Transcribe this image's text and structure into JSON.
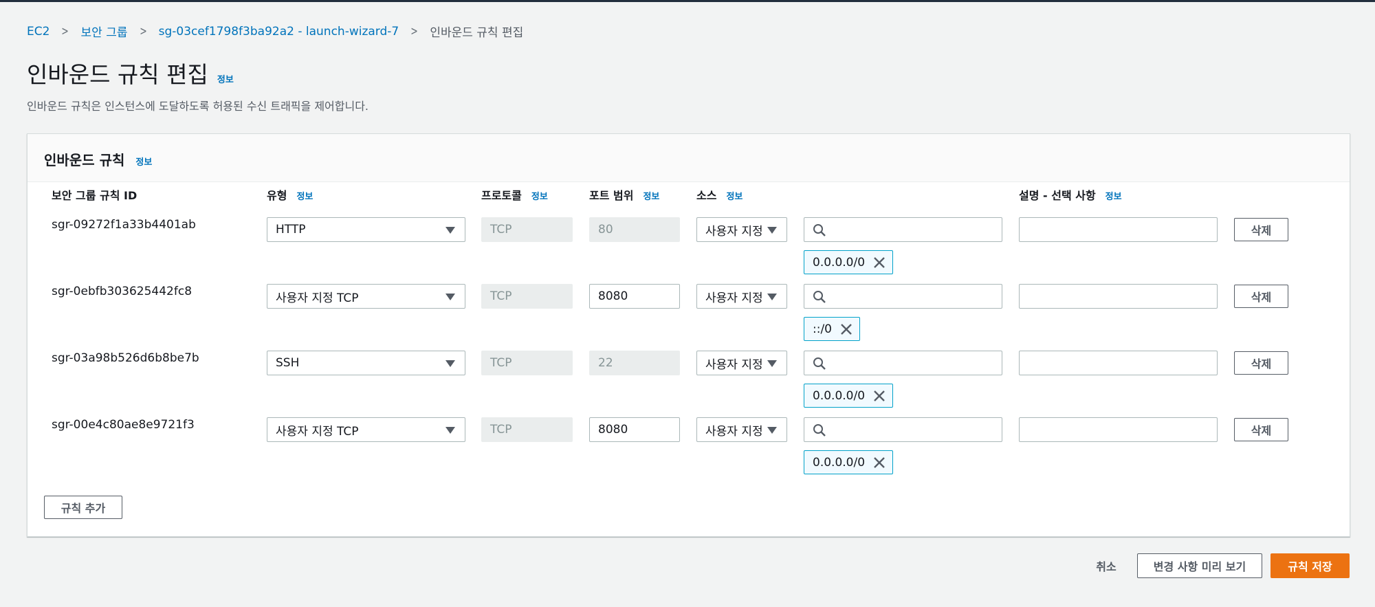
{
  "breadcrumb": {
    "items": [
      "EC2",
      "보안 그룹",
      "sg-03cef1798f3ba92a2 - launch-wizard-7"
    ],
    "current": "인바운드 규칙 편집"
  },
  "page": {
    "title": "인바운드 규칙 편집",
    "info": "정보",
    "description": "인바운드 규칙은 인스턴스에 도달하도록 허용된 수신 트래픽을 제어합니다."
  },
  "panel": {
    "title": "인바운드 규칙",
    "info": "정보",
    "columns": {
      "rule_id": "보안 그룹 규칙 ID",
      "type": "유형",
      "protocol": "프로토콜",
      "port_range": "포트 범위",
      "source": "소스",
      "description": "설명 - 선택 사항",
      "info": "정보"
    },
    "rules": [
      {
        "id": "sgr-09272f1a33b4401ab",
        "type": "HTTP",
        "protocol": "TCP",
        "port": "80",
        "port_editable": false,
        "source_type": "사용자 지정",
        "search_value": "",
        "cidr": "0.0.0.0/0",
        "description": "",
        "delete": "삭제"
      },
      {
        "id": "sgr-0ebfb303625442fc8",
        "type": "사용자 지정 TCP",
        "protocol": "TCP",
        "port": "8080",
        "port_editable": true,
        "source_type": "사용자 지정",
        "search_value": "",
        "cidr": "::/0",
        "description": "",
        "delete": "삭제"
      },
      {
        "id": "sgr-03a98b526d6b8be7b",
        "type": "SSH",
        "protocol": "TCP",
        "port": "22",
        "port_editable": false,
        "source_type": "사용자 지정",
        "search_value": "",
        "cidr": "0.0.0.0/0",
        "description": "",
        "delete": "삭제"
      },
      {
        "id": "sgr-00e4c80ae8e9721f3",
        "type": "사용자 지정 TCP",
        "protocol": "TCP",
        "port": "8080",
        "port_editable": true,
        "source_type": "사용자 지정",
        "search_value": "",
        "cidr": "0.0.0.0/0",
        "description": "",
        "delete": "삭제"
      }
    ],
    "add_rule": "규칙 추가"
  },
  "footer": {
    "cancel": "취소",
    "preview": "변경 사항 미리 보기",
    "save": "규칙 저장"
  },
  "colors": {
    "link": "#0073bb",
    "primary": "#ec7211",
    "token_border": "#00a1c9",
    "token_bg": "#f1faff"
  }
}
